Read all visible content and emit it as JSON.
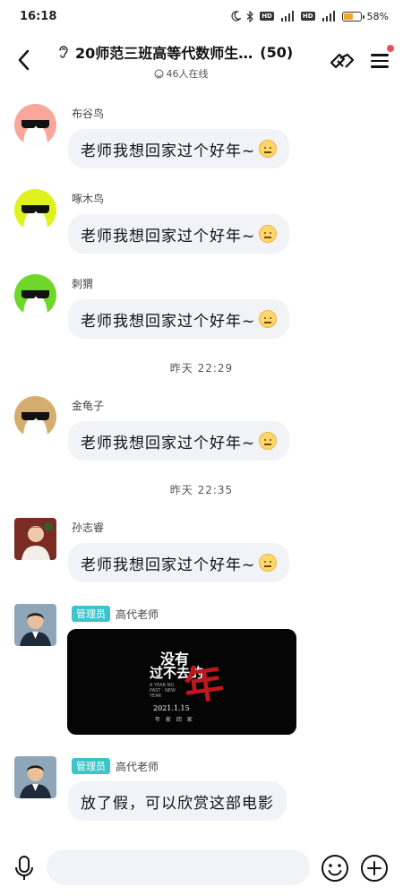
{
  "status_bar": {
    "time": "16:18",
    "network_1": "4G",
    "network_2": "5G",
    "hd_label": "HD",
    "battery_percent": "58%",
    "battery_level": 0.58
  },
  "header": {
    "title": "20师范三班高等代数师生…",
    "member_count": "(50)",
    "online": "46人在线"
  },
  "messages": [
    {
      "sender": "布谷鸟",
      "text": "老师我想回家过个好年~"
    },
    {
      "sender": "啄木鸟",
      "text": "老师我想回家过个好年~"
    },
    {
      "sender": "刺猬",
      "text": "老师我想回家过个好年~"
    },
    {
      "sender": "金龟子",
      "text": "老师我想回家过个好年~"
    },
    {
      "sender": "孙志睿",
      "text": "老师我想回家过个好年~"
    },
    {
      "sender": "高代老师",
      "role": "管理员"
    },
    {
      "sender": "高代老师",
      "role": "管理员",
      "text": "放了假，可以欣赏这部电影"
    }
  ],
  "time_separators": [
    "昨天 22:29",
    "昨天 22:35"
  ],
  "poster": {
    "line1": "没有",
    "line2": "过不去的",
    "char": "年",
    "small_text": "A YEAR NO PAST · NEW YEAR",
    "date": "2021.1.15",
    "sub": "年 家 回 家"
  },
  "input": {
    "placeholder": ""
  }
}
